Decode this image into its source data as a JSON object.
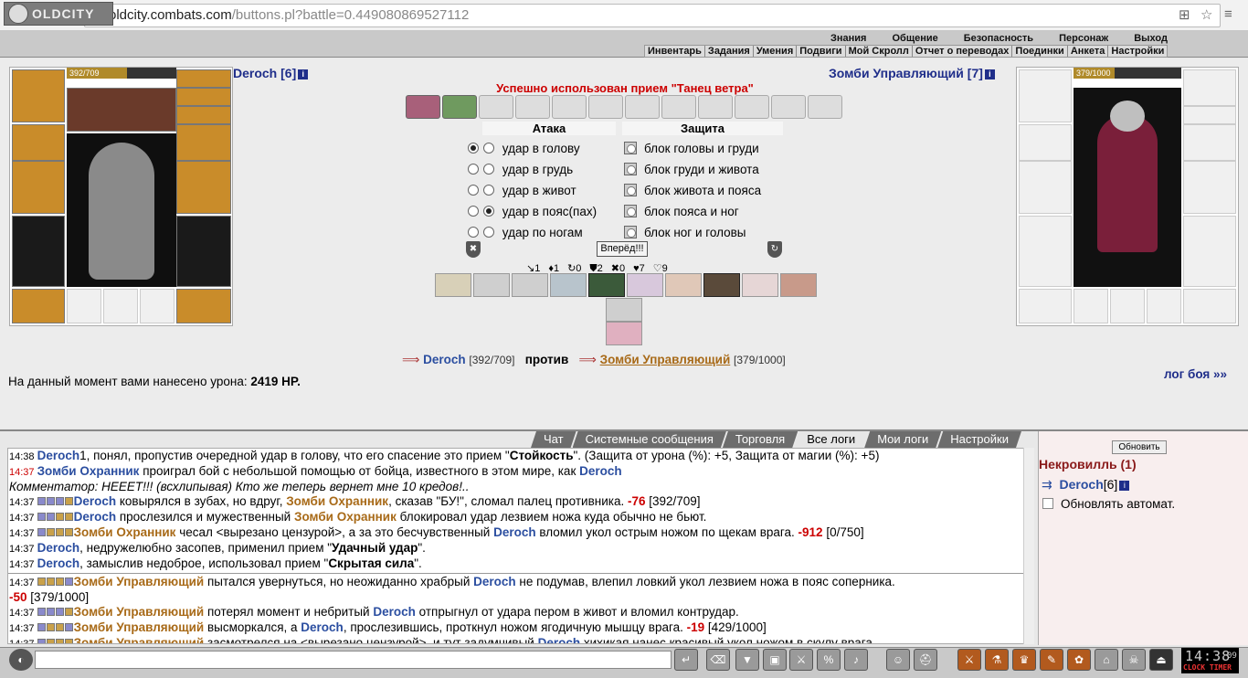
{
  "browser": {
    "url_host": "oldcity.combats.com",
    "url_path": "/buttons.pl?battle=0.449080869527112"
  },
  "game": {
    "logo": "OLDCITY"
  },
  "menu_top": [
    "Знания",
    "Общение",
    "Безопасность",
    "Персонаж",
    "Выход"
  ],
  "menu_sub": [
    "Инвентарь",
    "Задания",
    "Умения",
    "Подвиги",
    "Мой Скролл",
    "Отчет о переводах",
    "Поединки",
    "Анкета",
    "Настройки"
  ],
  "player": {
    "name": "Deroch [6]",
    "hp": "392/709",
    "hp_fraction": 0.553
  },
  "enemy": {
    "name": "Зомби Управляющий [7]",
    "hp": "379/1000",
    "hp_fraction": 0.379
  },
  "battle_message": "Успешно использован прием \"Танец ветра\"",
  "attack": {
    "header": "Атака",
    "rows": [
      "удар в голову",
      "удар в грудь",
      "удар в живот",
      "удар в пояс(пах)",
      "удар по ногам"
    ],
    "selected": [
      true,
      false,
      false,
      false,
      false
    ],
    "selected2": [
      false,
      false,
      false,
      true,
      false
    ]
  },
  "defense": {
    "header": "Защита",
    "rows": [
      "блок головы и груди",
      "блок груди и живота",
      "блок живота и пояса",
      "блок пояса и ног",
      "блок ног и головы"
    ]
  },
  "go_button": "Вперёд!!!",
  "stats": [
    "↘1",
    "♦1",
    "↻0",
    "⛊2",
    "✖0",
    "♥7",
    "♡9"
  ],
  "vs": {
    "me": "Deroch",
    "me_hp": "[392/709]",
    "against": "против",
    "enemy": "Зомби Управляющий",
    "enemy_hp": "[379/1000]"
  },
  "damage": {
    "label": "На данный момент вами нанесено урона:",
    "value": "2419 HP."
  },
  "log_link": "лог боя »»",
  "tabs": [
    "Чат",
    "Системные сообщения",
    "Торговля",
    "Все логи",
    "Мои логи",
    "Настройки"
  ],
  "active_tab": 3,
  "log": [
    {
      "time": "14:38",
      "parts": [
        [
          "n1",
          "Deroch"
        ],
        [
          "",
          "1, понял, пропустив очередной удар в голову, что его спасение это прием \""
        ],
        [
          "b",
          "Стойкость"
        ],
        [
          "",
          "\". (Защита от урона (%): +5, Защита от магии (%): +5)"
        ]
      ]
    },
    {
      "time": "14:37",
      "red": true,
      "parts": [
        [
          "n1",
          "Зомби Охранник"
        ],
        [
          "",
          " проиграл бой с небольшой помощью от бойца, известного в этом мире, как "
        ],
        [
          "n1",
          "Deroch"
        ]
      ]
    },
    {
      "time": "",
      "parts": [
        [
          "i",
          "Комментатор: НЕЕЕТ!!! (всхлипывая) Кто же теперь вернет мне 10 кредов!.."
        ]
      ]
    },
    {
      "time": "14:37",
      "marks": "sssf",
      "parts": [
        [
          "n1",
          "Deroch"
        ],
        [
          "",
          " ковырялся в зубах, но вдруг, "
        ],
        [
          "n2",
          "Зомби Охранник"
        ],
        [
          "",
          ", сказав \"БУ!\", сломал палец противника. "
        ],
        [
          "red",
          "-76"
        ],
        [
          "",
          " [392/709]"
        ]
      ]
    },
    {
      "time": "14:37",
      "marks": "ssff",
      "parts": [
        [
          "n1",
          "Deroch"
        ],
        [
          "",
          " прослезился и мужественный "
        ],
        [
          "n2",
          "Зомби Охранник"
        ],
        [
          "",
          " блокировал удар лезвием ножа куда обычно не бьют."
        ]
      ]
    },
    {
      "time": "14:37",
      "marks": "sfff",
      "parts": [
        [
          "n2",
          "Зомби Охранник"
        ],
        [
          "",
          " чесал <вырезано цензурой>, а за это бесчувственный "
        ],
        [
          "n1",
          "Deroch"
        ],
        [
          "",
          " вломил укол острым ножом по щекам врага. "
        ],
        [
          "red",
          "-912"
        ],
        [
          "",
          " [0/750]"
        ]
      ]
    },
    {
      "time": "14:37",
      "parts": [
        [
          "n1",
          "Deroch"
        ],
        [
          "",
          ", недружелюбно засопев, применил прием \""
        ],
        [
          "b",
          "Удачный удар"
        ],
        [
          "",
          "\"."
        ]
      ]
    },
    {
      "time": "14:37",
      "parts": [
        [
          "n1",
          "Deroch"
        ],
        [
          "",
          ", замыслив недоброе, использовал прием \""
        ],
        [
          "b",
          "Скрытая сила"
        ],
        [
          "",
          "\"."
        ]
      ]
    },
    {
      "sep": true
    },
    {
      "time": "14:37",
      "marks": "fffs",
      "parts": [
        [
          "n2",
          "Зомби Управляющий"
        ],
        [
          "",
          " пытался увернуться, но неожиданно храбрый "
        ],
        [
          "n1",
          "Deroch"
        ],
        [
          "",
          " не подумав, влепил ловкий укол лезвием ножа в пояс соперника."
        ]
      ]
    },
    {
      "time": "",
      "parts": [
        [
          "red",
          "-50"
        ],
        [
          "",
          " [379/1000]"
        ]
      ]
    },
    {
      "time": "14:37",
      "marks": "sssf",
      "parts": [
        [
          "n2",
          "Зомби Управляющий"
        ],
        [
          "",
          " потерял момент и небритый "
        ],
        [
          "n1",
          "Deroch"
        ],
        [
          "",
          " отпрыгнул от удара пером в живот и вломил контрудар."
        ]
      ]
    },
    {
      "time": "14:37",
      "marks": "sffs",
      "parts": [
        [
          "n2",
          "Зомби Управляющий"
        ],
        [
          "",
          " высморкался, а "
        ],
        [
          "n1",
          "Deroch"
        ],
        [
          "",
          ", прослезившись, проткнул ножом ягодичную мышцу врага. "
        ],
        [
          "red",
          "-19"
        ],
        [
          "",
          " [429/1000]"
        ]
      ]
    },
    {
      "time": "14:37",
      "marks": "sfff",
      "parts": [
        [
          "n2",
          "Зомби Управляющий"
        ],
        [
          "",
          " засмотрелся на <вырезано цензурой>, и тут задумчивый "
        ],
        [
          "n1",
          "Deroch"
        ],
        [
          "",
          " хихикая нанес красивый укол ножом в скулу врага."
        ]
      ]
    }
  ],
  "side": {
    "refresh": "Обновить",
    "title": "Некровилль (1)",
    "user": "Deroch",
    "user_level": "[6]",
    "auto": "Обновлять автомат."
  },
  "clock": {
    "time": "14:38",
    "sec": "09",
    "label": "CLOCK TIMER"
  }
}
